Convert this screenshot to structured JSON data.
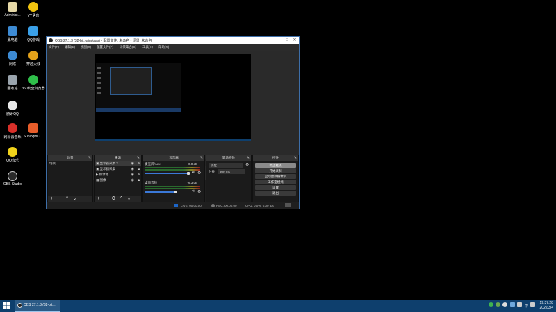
{
  "desktop": {
    "icons": [
      {
        "label": "Administ...",
        "color": "#e6d9a8"
      },
      {
        "label": "YY语音",
        "color": "#f1c40f"
      },
      {
        "label": "此电脑",
        "color": "#3d8bd4"
      },
      {
        "label": "QQ游戏",
        "color": "#3aa0e8"
      },
      {
        "label": "网络",
        "color": "#3d8bd4"
      },
      {
        "label": "穿越火线",
        "color": "#e4a21a"
      },
      {
        "label": "回收站",
        "color": "#9aa4ad"
      },
      {
        "label": "360安全浏览器",
        "color": "#2fbf4a"
      },
      {
        "label": "腾讯QQ",
        "color": "#e8e8e8"
      },
      {
        "label": "网易云音乐",
        "color": "#d9302a"
      },
      {
        "label": "SunloginCl...",
        "color": "#e85d2a"
      },
      {
        "label": "QQ音乐",
        "color": "#f1d31b"
      },
      {
        "label": "OBS Studio",
        "color": "#2a2a2a"
      }
    ]
  },
  "obs": {
    "title": "OBS 27.1.3 (32-bit, windows) - 配置文件: 未命名 - 场景: 未命名",
    "menu": [
      "文件(F)",
      "编辑(E)",
      "视图(V)",
      "配置文件(P)",
      "场景集合(S)",
      "工具(T)",
      "帮助(H)"
    ],
    "no_source": "未选择源",
    "props_btn": "属性",
    "filters_btn": "滤镜",
    "docks": {
      "scenes": {
        "title": "场景",
        "items": [
          "场景"
        ]
      },
      "sources": {
        "title": "来源",
        "items": [
          "显示器采集 2",
          "显示器采集",
          "媒体源",
          "图像"
        ]
      },
      "mixer": {
        "title": "混音器",
        "channels": [
          {
            "name": "麦克风/Aux",
            "db": "0.0 dB"
          },
          {
            "name": "桌面音频",
            "db": "-6.3 dB"
          }
        ]
      },
      "transitions": {
        "title": "转场特效",
        "type": "淡化",
        "duration_label": "时长",
        "duration": "300 ms"
      },
      "controls": {
        "title": "控件",
        "buttons": [
          "停止推流",
          "开始录制",
          "启动虚拟摄像机",
          "工作室模式",
          "设置",
          "退出"
        ]
      }
    },
    "status": {
      "live": "LIVE: 00:00:00",
      "rec": "REC: 00:00:00",
      "cpu": "CPU: 0.0%, 0.00 fps"
    }
  },
  "taskbar": {
    "app_label": "OBS 27.1.3 (32-bit...",
    "time": "19:37:28",
    "date": "2022/3/4",
    "tray_label": "中"
  }
}
